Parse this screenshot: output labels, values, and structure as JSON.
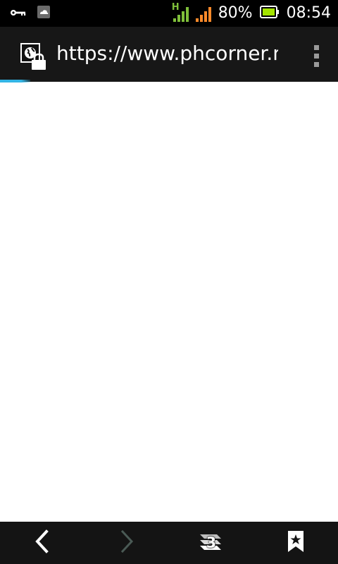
{
  "status_bar": {
    "network_type": "H",
    "battery_percent": "80%",
    "time": "08:54",
    "colors": {
      "signal_primary": "#7fbf3a",
      "signal_secondary": "#ff8a2a",
      "battery_fill": "#a4e400"
    },
    "icons": [
      "vpn-key-icon",
      "cloud-sync-icon",
      "signal-icon",
      "signal-icon",
      "battery-icon"
    ]
  },
  "toolbar": {
    "url": "https://www.phcorner.net",
    "site_icon": "secure-globe-icon",
    "menu_icon": "overflow-menu-icon",
    "page_load_progress": 0.09,
    "colors": {
      "progress": "#33b5e5"
    }
  },
  "bottom_nav": {
    "tabs_count": "3",
    "icons": [
      "back-icon",
      "forward-icon",
      "tabs-icon",
      "bookmarks-icon"
    ]
  }
}
